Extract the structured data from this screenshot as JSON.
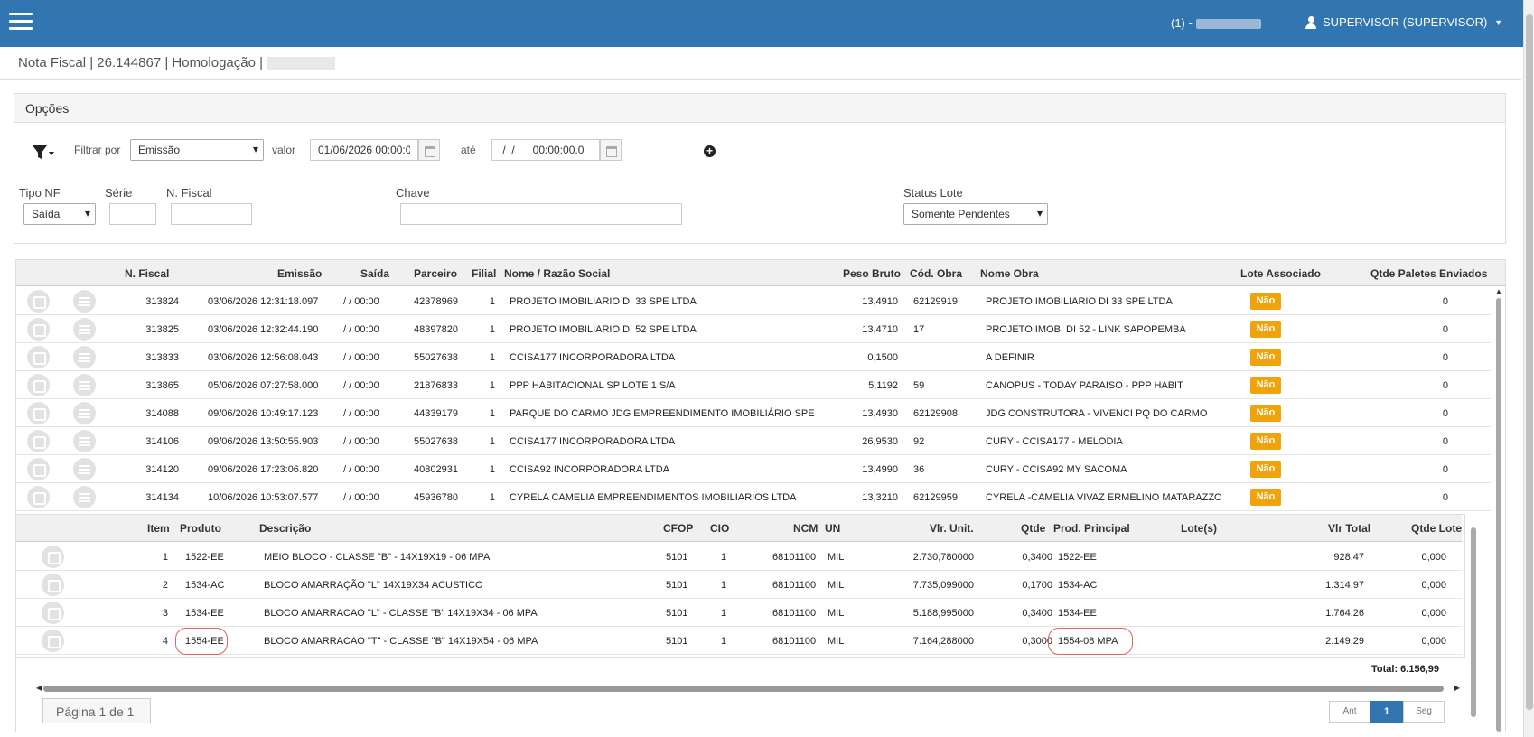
{
  "topbar": {
    "company_prefix": "(1) -",
    "user": "SUPERVISOR (SUPERVISOR)"
  },
  "breadcrumb": "Nota Fiscal | 26.144867 | Homologação |",
  "options": {
    "title": "Opções",
    "filter_label": "Filtrar por",
    "filter_value": "Emissão",
    "value_label": "valor",
    "value_from": "01/06/2026 00:00:0",
    "until_label": "até",
    "value_to": " /  /      00:00:00.0",
    "tipo_nf_label": "Tipo NF",
    "tipo_nf_value": "Saída",
    "serie_label": "Série",
    "nfiscal_label": "N. Fiscal",
    "chave_label": "Chave",
    "status_label": "Status Lote",
    "status_value": "Somente Pendentes"
  },
  "grid": {
    "headers": {
      "nfiscal": "N. Fiscal",
      "emissao": "Emissão",
      "saida": "Saída",
      "parceiro": "Parceiro",
      "filial": "Filial",
      "nome": "Nome / Razão Social",
      "peso": "Peso Bruto",
      "cod_obra": "Cód. Obra",
      "nome_obra": "Nome Obra",
      "lote": "Lote Associado",
      "paletes": "Qtde Paletes Enviados"
    },
    "rows": [
      {
        "nf": "313824",
        "emissao": "03/06/2026 12:31:18.097",
        "saida": " /  / 00:00",
        "parceiro": "42378969",
        "filial": "1",
        "nome": "PROJETO IMOBILIARIO DI 33 SPE LTDA",
        "peso": "13,4910",
        "cod": "62129919",
        "obra": "PROJETO IMOBILIARIO DI 33 SPE LTDA",
        "lote": "Não",
        "paletes": "0"
      },
      {
        "nf": "313825",
        "emissao": "03/06/2026 12:32:44.190",
        "saida": " /  / 00:00",
        "parceiro": "48397820",
        "filial": "1",
        "nome": "PROJETO IMOBILIARIO DI 52 SPE LTDA",
        "peso": "13,4710",
        "cod": "17",
        "obra": "PROJETO IMOB. DI 52 - LINK SAPOPEMBA",
        "lote": "Não",
        "paletes": "0"
      },
      {
        "nf": "313833",
        "emissao": "03/06/2026 12:56:08.043",
        "saida": " /  / 00:00",
        "parceiro": "55027638",
        "filial": "1",
        "nome": "CCISA177 INCORPORADORA LTDA",
        "peso": "0,1500",
        "cod": "",
        "obra": "A DEFINIR",
        "lote": "Não",
        "paletes": "0"
      },
      {
        "nf": "313865",
        "emissao": "05/06/2026 07:27:58.000",
        "saida": " /  / 00:00",
        "parceiro": "21876833",
        "filial": "1",
        "nome": "PPP HABITACIONAL SP LOTE 1 S/A",
        "peso": "5,1192",
        "cod": "59",
        "obra": "CANOPUS - TODAY PARAISO - PPP HABIT",
        "lote": "Não",
        "paletes": "0"
      },
      {
        "nf": "314088",
        "emissao": "09/06/2026 10:49:17.123",
        "saida": " /  / 00:00",
        "parceiro": "44339179",
        "filial": "1",
        "nome": "PARQUE DO CARMO JDG EMPREENDIMENTO IMOBILIÁRIO SPE",
        "peso": "13,4930",
        "cod": "62129908",
        "obra": "JDG CONSTRUTORA - VIVENCI PQ DO CARMO",
        "lote": "Não",
        "paletes": "0"
      },
      {
        "nf": "314106",
        "emissao": "09/06/2026 13:50:55.903",
        "saida": " /  / 00:00",
        "parceiro": "55027638",
        "filial": "1",
        "nome": "CCISA177 INCORPORADORA LTDA",
        "peso": "26,9530",
        "cod": "92",
        "obra": "CURY - CCISA177 - MELODIA",
        "lote": "Não",
        "paletes": "0"
      },
      {
        "nf": "314120",
        "emissao": "09/06/2026 17:23:06.820",
        "saida": " /  / 00:00",
        "parceiro": "40802931",
        "filial": "1",
        "nome": "CCISA92 INCORPORADORA LTDA",
        "peso": "13,4990",
        "cod": "36",
        "obra": "CURY - CCISA92 MY SACOMA",
        "lote": "Não",
        "paletes": "0"
      },
      {
        "nf": "314134",
        "emissao": "10/06/2026 10:53:07.577",
        "saida": " /  / 00:00",
        "parceiro": "45936780",
        "filial": "1",
        "nome": "CYRELA CAMELIA EMPREENDIMENTOS IMOBILIARIOS LTDA",
        "peso": "13,3210",
        "cod": "62129959",
        "obra": "CYRELA -CAMELIA VIVAZ ERMELINO MATARAZZO",
        "lote": "Não",
        "paletes": "0"
      }
    ]
  },
  "detail": {
    "headers": {
      "item": "Item",
      "produto": "Produto",
      "descricao": "Descrição",
      "cfop": "CFOP",
      "cio": "CIO",
      "ncm": "NCM",
      "un": "UN",
      "vlr_unit": "Vlr. Unit.",
      "qtde": "Qtde",
      "prod_principal": "Prod. Principal",
      "lotes": "Lote(s)",
      "vlr_total": "Vlr Total",
      "qtde_lote": "Qtde Lote"
    },
    "rows": [
      {
        "item": "1",
        "produto": "1522-EE",
        "descricao": "MEIO BLOCO - CLASSE \"B\" - 14X19X19 - 06 MPA",
        "cfop": "5101",
        "cio": "1",
        "ncm": "68101100",
        "un": "MIL",
        "vlr_unit": "2.730,780000",
        "qtde": "0,3400",
        "principal": "1522-EE",
        "total": "928,47",
        "qtde_lote": "0,000"
      },
      {
        "item": "2",
        "produto": "1534-AC",
        "descricao": "BLOCO AMARRAÇÃO \"L\" 14X19X34 ACUSTICO",
        "cfop": "5101",
        "cio": "1",
        "ncm": "68101100",
        "un": "MIL",
        "vlr_unit": "7.735,099000",
        "qtde": "0,1700",
        "principal": "1534-AC",
        "total": "1.314,97",
        "qtde_lote": "0,000"
      },
      {
        "item": "3",
        "produto": "1534-EE",
        "descricao": "BLOCO AMARRACAO \"L\" - CLASSE \"B\" 14X19X34 - 06 MPA",
        "cfop": "5101",
        "cio": "1",
        "ncm": "68101100",
        "un": "MIL",
        "vlr_unit": "5.188,995000",
        "qtde": "0,3400",
        "principal": "1534-EE",
        "total": "1.764,26",
        "qtde_lote": "0,000"
      },
      {
        "item": "4",
        "produto": "1554-EE",
        "descricao": "BLOCO AMARRACAO \"T\" - CLASSE \"B\" 14X19X54 - 06 MPA",
        "cfop": "5101",
        "cio": "1",
        "ncm": "68101100",
        "un": "MIL",
        "vlr_unit": "7.164,288000",
        "qtde": "0,3000",
        "principal": "1554-08 MPA",
        "total": "2.149,29",
        "qtde_lote": "0,000"
      }
    ],
    "total": "Total: 6.156,99"
  },
  "pager": {
    "info": "Página 1 de 1",
    "prev": "Ant",
    "current": "1",
    "next": "Seg"
  },
  "colors": {
    "topbar": "#3276b1",
    "badge": "#f0a30a",
    "highlight": "#e06060"
  }
}
